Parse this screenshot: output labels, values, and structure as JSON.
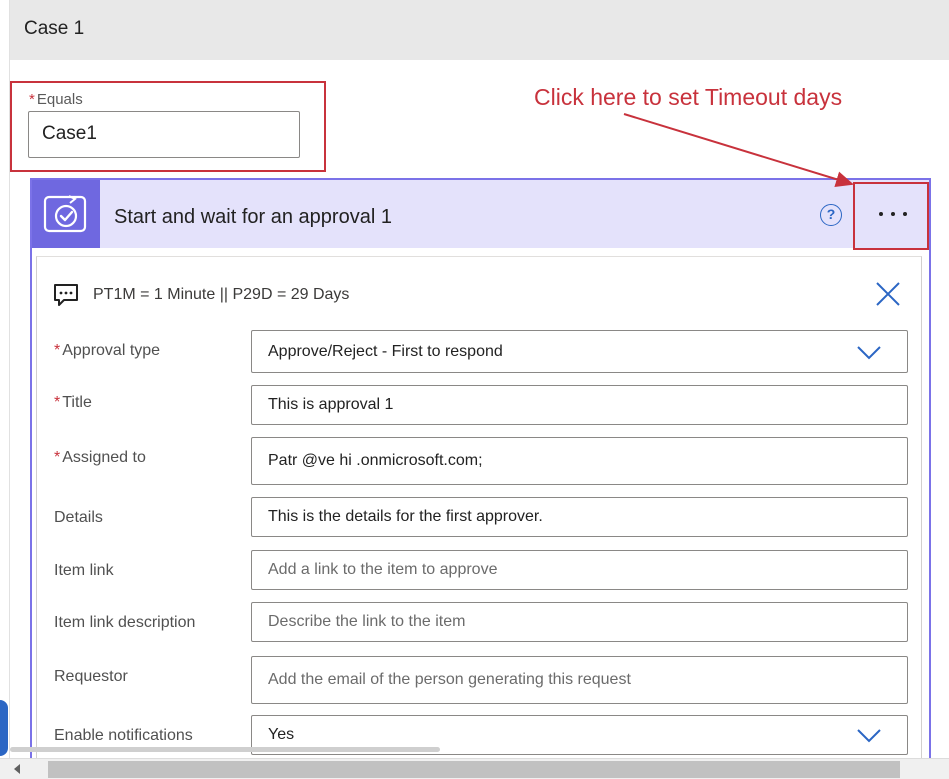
{
  "case_header": {
    "title": "Case 1"
  },
  "equals": {
    "required_mark": "*",
    "label": "Equals",
    "value": "Case1"
  },
  "annotation": {
    "text": "Click here to set Timeout days",
    "color": "#c8323c"
  },
  "card": {
    "title": "Start and wait for an approval 1",
    "help_glyph": "?",
    "icon": "approval-check-icon",
    "accent": "#6f68e0",
    "header_bg": "#e4e2fb",
    "comment": "PT1M = 1 Minute || P29D = 29 Days"
  },
  "fields": [
    {
      "label": "Approval type",
      "required": true,
      "value": "Approve/Reject - First to respond",
      "placeholder": "",
      "dropdown": true
    },
    {
      "label": "Title",
      "required": true,
      "value": "This is approval 1",
      "placeholder": "",
      "dropdown": false
    },
    {
      "label": "Assigned to",
      "required": true,
      "value": "Patr @ve    hi  .onmicrosoft.com;",
      "placeholder": "",
      "dropdown": false
    },
    {
      "label": "Details",
      "required": false,
      "value": "This is the details for the first approver.",
      "placeholder": "",
      "dropdown": false
    },
    {
      "label": "Item link",
      "required": false,
      "value": "",
      "placeholder": "Add a link to the item to approve",
      "dropdown": false
    },
    {
      "label": "Item link description",
      "required": false,
      "value": "",
      "placeholder": "Describe the link to the item",
      "dropdown": false
    },
    {
      "label": "Requestor",
      "required": false,
      "value": "",
      "placeholder": "Add the email of the person generating this request",
      "dropdown": false
    },
    {
      "label": "Enable notifications",
      "required": false,
      "value": "Yes",
      "placeholder": "",
      "dropdown": true
    }
  ]
}
